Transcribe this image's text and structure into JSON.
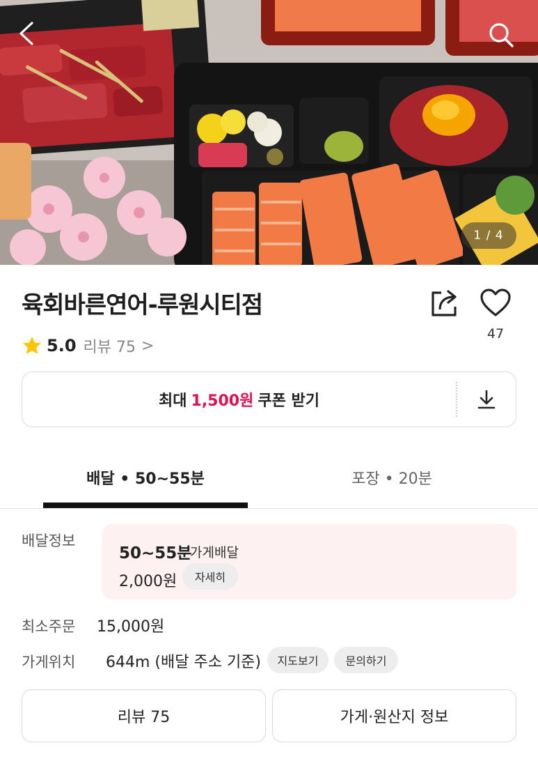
{
  "hero": {
    "page_counter": "1 / 4"
  },
  "store": {
    "name": "육회바른연어-루원시티점",
    "like_count": "47",
    "rating": "5.0",
    "review_label": "리뷰 75",
    "review_chevron": ">"
  },
  "coupon": {
    "prefix": "최대",
    "amount": "1,500원",
    "suffix": "쿠폰 받기"
  },
  "tabs": [
    {
      "label": "배달 • 50~55분",
      "selected": true
    },
    {
      "label": "포장 • 20분",
      "selected": false
    }
  ],
  "delivery_info": {
    "label": "배달정보",
    "time": "50~55분",
    "type": "가게배달",
    "fee": "2,000원",
    "detail_chip": "자세히"
  },
  "min_order": {
    "label": "최소주문",
    "value": "15,000원"
  },
  "location": {
    "label": "가게위치",
    "value": "644m (배달 주소 기준)",
    "map_chip": "지도보기",
    "inquiry_chip": "문의하기"
  },
  "bottom_buttons": {
    "review": "리뷰 75",
    "store_info": "가게·원산지 정보"
  },
  "colors": {
    "accent": "#e0114f",
    "delivery_box_bg": "#fdf1f2",
    "star": "#ffc400"
  },
  "icons": [
    "back-arrow-icon",
    "search-icon",
    "share-icon",
    "heart-icon",
    "star-icon",
    "download-icon"
  ]
}
